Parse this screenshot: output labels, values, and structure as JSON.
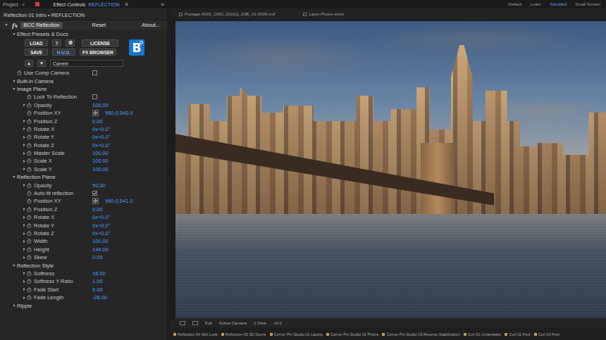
{
  "panel_tabs": {
    "project": "Project",
    "close": "×",
    "effect_controls": "Effect Controls",
    "layer": "REFLECTION",
    "menu": "≡",
    "overflow": "»"
  },
  "workspaces": [
    {
      "label": "Default",
      "selected": false
    },
    {
      "label": "Learn",
      "selected": false
    },
    {
      "label": "Standard",
      "selected": true
    },
    {
      "label": "Small Screen",
      "selected": false
    }
  ],
  "viewer_tabs": [
    {
      "label": "Footage A003_C062_0101Q_S0B_V1-0000.mxf"
    },
    {
      "label": "Layer Phone sizes"
    }
  ],
  "breadcrumb": "Reflection 01 Intro • REFLECTION",
  "effect": {
    "fx": "fx",
    "name": "BCC Reflection",
    "reset": "Reset",
    "about": "About...",
    "expanded": true
  },
  "presets": {
    "title": "Effect Presets & Docs",
    "expanded": true,
    "row1": [
      {
        "label": "LOAD",
        "on": false
      },
      {
        "label": "?",
        "on": false
      },
      {
        "label": "⚙",
        "on": false
      },
      {
        "label": "LICENSE",
        "on": false
      }
    ],
    "row2": [
      {
        "label": "SAVE",
        "on": false
      },
      {
        "label": "H.U.D.",
        "on": true
      },
      {
        "label": "FX BROWSER",
        "on": false
      }
    ],
    "up": "▲",
    "down": "▼",
    "preset": "Current",
    "logo": "B"
  },
  "params": [
    {
      "kind": "checkbox",
      "label": "Use Comp Camera",
      "checked": false
    },
    {
      "kind": "group",
      "label": "Built-in Camera",
      "expanded": false,
      "children": []
    },
    {
      "kind": "group",
      "label": "Image Plane",
      "expanded": true,
      "children": [
        {
          "kind": "checkbox",
          "label": "Lock To Reflection",
          "checked": false
        },
        {
          "kind": "value",
          "label": "Opacity",
          "value": "100.00",
          "expanded": false
        },
        {
          "kind": "point",
          "label": "Position XY",
          "value": "960.0,540.0"
        },
        {
          "kind": "value",
          "label": "Position Z",
          "value": "0.00",
          "expanded": false
        },
        {
          "kind": "value",
          "label": "Rotate X",
          "value": "0x+0.0°",
          "expanded": false
        },
        {
          "kind": "value",
          "label": "Rotate Y",
          "value": "0x+0.0°",
          "expanded": false
        },
        {
          "kind": "value",
          "label": "Rotate Z",
          "value": "0x+0.0°",
          "expanded": false
        },
        {
          "kind": "value",
          "label": "Master Scale",
          "value": "100.00",
          "expanded": false
        },
        {
          "kind": "value",
          "label": "Scale X",
          "value": "100.00",
          "expanded": false
        },
        {
          "kind": "value",
          "label": "Scale Y",
          "value": "100.00",
          "expanded": false
        }
      ]
    },
    {
      "kind": "group",
      "label": "Reflection Plane",
      "expanded": true,
      "children": [
        {
          "kind": "value",
          "label": "Opacity",
          "value": "50.00",
          "expanded": false
        },
        {
          "kind": "checkbox",
          "label": "Auto-fit reflection",
          "checked": true
        },
        {
          "kind": "point",
          "label": "Position XY",
          "value": "960.0,541.0"
        },
        {
          "kind": "value",
          "label": "Position Z",
          "value": "0.00",
          "expanded": false
        },
        {
          "kind": "value",
          "label": "Rotate X",
          "value": "0x+0.0°",
          "expanded": false
        },
        {
          "kind": "value",
          "label": "Rotate Y",
          "value": "0x+0.0°",
          "expanded": false
        },
        {
          "kind": "value",
          "label": "Rotate Z",
          "value": "0x+0.0°",
          "expanded": false
        },
        {
          "kind": "value",
          "label": "Width",
          "value": "100.00",
          "expanded": false
        },
        {
          "kind": "value",
          "label": "Height",
          "value": "144.00",
          "expanded": false
        },
        {
          "kind": "value",
          "label": "Skew",
          "value": "0.00",
          "expanded": false
        }
      ]
    },
    {
      "kind": "group",
      "label": "Reflection Style",
      "expanded": true,
      "children": [
        {
          "kind": "value",
          "label": "Softness",
          "value": "18.00",
          "expanded": false
        },
        {
          "kind": "value",
          "label": "Softness Y Ratio",
          "value": "1.00",
          "expanded": false
        },
        {
          "kind": "value",
          "label": "Fade Start",
          "value": "0.00",
          "expanded": false
        },
        {
          "kind": "value",
          "label": "Fade Length",
          "value": "-28.00",
          "expanded": false
        }
      ]
    },
    {
      "kind": "group",
      "label": "Ripple",
      "expanded": false,
      "children": []
    }
  ],
  "viewer_toolbar": [
    "Full",
    "Active Camera",
    "1 View",
    "+0.0"
  ],
  "comp_tabs": [
    "Reflection 04 Wet Look",
    "Reflection 05 3D Scene",
    "Corner Pin Studio 01 Laptop",
    "Corner Pin Studio 02 Phone",
    "Corner Pin Studio 03 Reverse Stabilization",
    "Curl 01 Underwater",
    "Curl 02 Pool",
    "Curl 03 Peel"
  ]
}
